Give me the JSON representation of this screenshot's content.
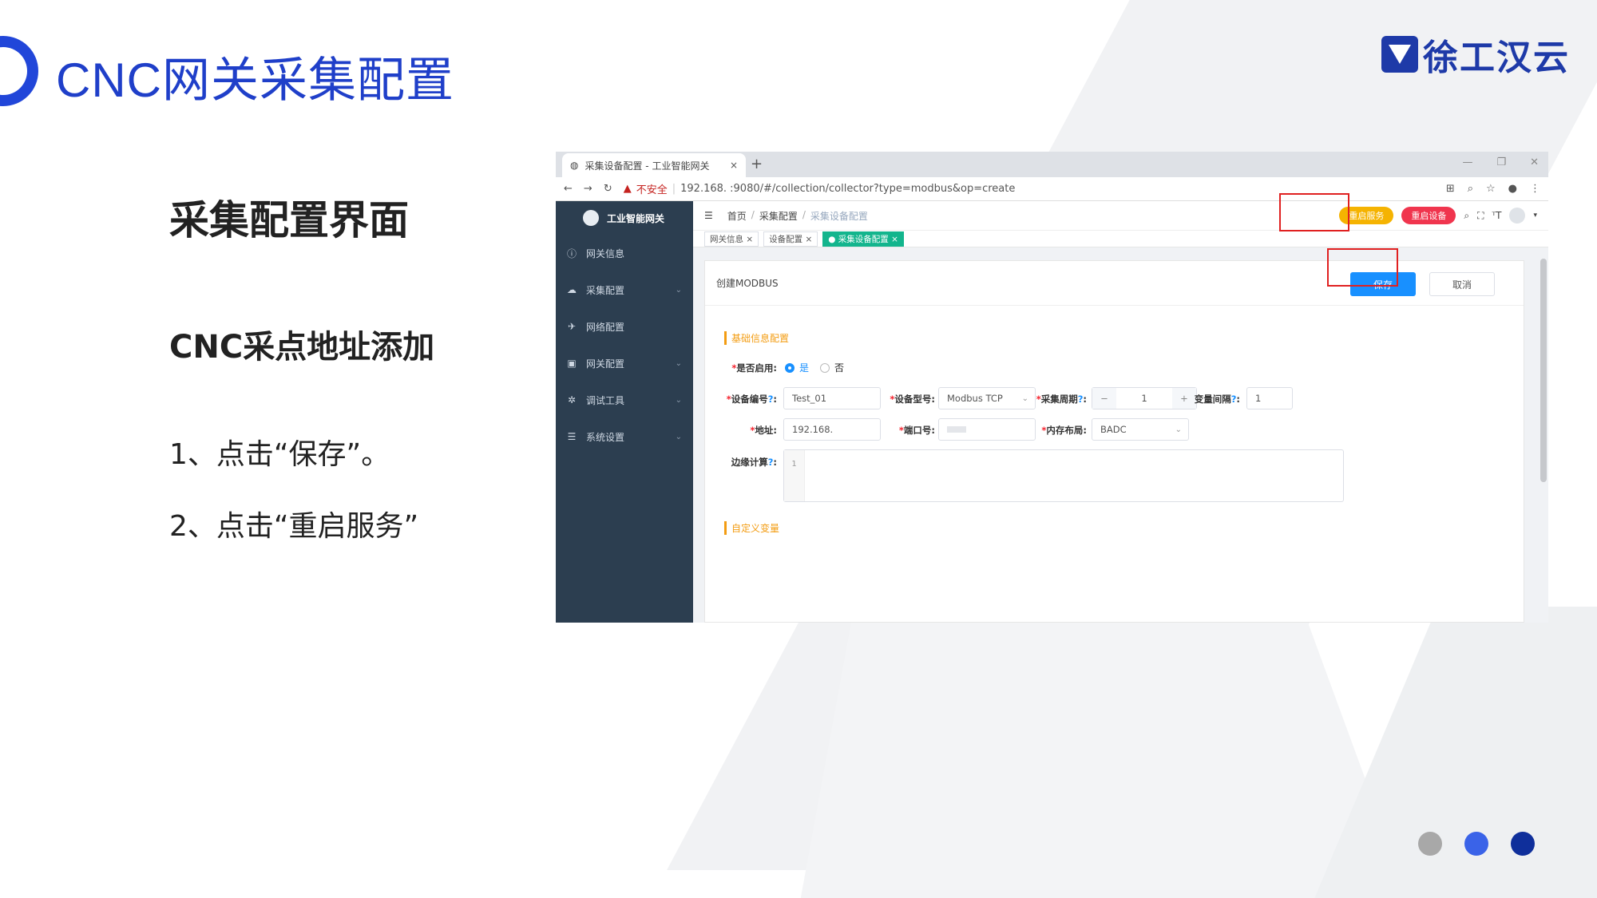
{
  "slide": {
    "title": "CNC网关采集配置",
    "logo_text": "徐工汉云",
    "heading": "采集配置界面",
    "subheading": "CNC采点地址添加",
    "steps": [
      "1、点击“保存”。",
      "2、点击“重启服务”"
    ],
    "dot_colors": [
      "#a8a8a8",
      "#3a63e8",
      "#0f2f9b"
    ]
  },
  "browser": {
    "tab_title": "采集设备配置 - 工业智能网关",
    "tab_close": "×",
    "new_tab": "+",
    "insecure_label": "不安全",
    "url": "192.168.        :9080/#/collection/collector?type=modbus&op=create"
  },
  "sidebar": {
    "brand": "工业智能网关",
    "items": [
      {
        "label": "网关信息",
        "icon": "ⓘ",
        "has_arrow": false
      },
      {
        "label": "采集配置",
        "icon": "☁",
        "has_arrow": true
      },
      {
        "label": "网络配置",
        "icon": "✈",
        "has_arrow": false
      },
      {
        "label": "网关配置",
        "icon": "▣",
        "has_arrow": true
      },
      {
        "label": "调试工具",
        "icon": "✲",
        "has_arrow": true
      },
      {
        "label": "系统设置",
        "icon": "☰",
        "has_arrow": true
      }
    ]
  },
  "topnav": {
    "breadcrumb": [
      "首页",
      "采集配置",
      "采集设备配置"
    ],
    "restart_service": "重启服务",
    "restart_device": "重启设备"
  },
  "tags": [
    "网关信息",
    "设备配置",
    "采集设备配置"
  ],
  "form": {
    "title": "创建MODBUS",
    "save": "保存",
    "cancel": "取消",
    "section_basic": "基础信息配置",
    "section_custom": "自定义变量",
    "enabled_label": "是否启用",
    "enabled_yes": "是",
    "enabled_no": "否",
    "device_id_label": "设备编号",
    "device_id": "Test_01",
    "device_model_label": "设备型号",
    "device_model": "Modbus TCP",
    "period_label": "采集周期",
    "period": "1",
    "interval_label": "变量间隔",
    "interval": "1",
    "address_label": "地址",
    "address": "192.168.",
    "port_label": "端口号",
    "memory_label": "内存布局",
    "memory": "BADC",
    "edge_label": "边缘计算",
    "edge_line": "1"
  }
}
